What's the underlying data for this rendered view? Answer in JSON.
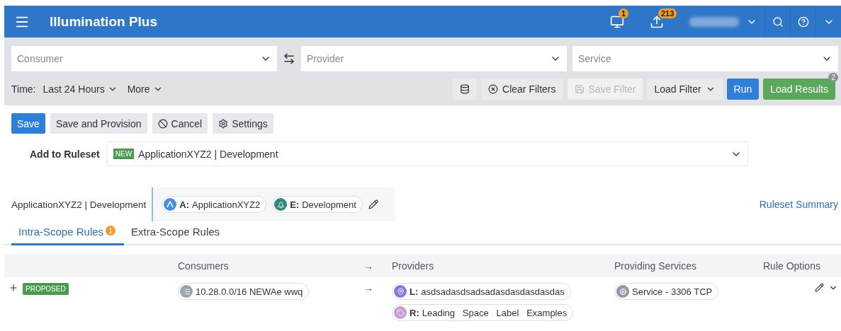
{
  "header": {
    "title": "Illumination Plus",
    "notifications": [
      {
        "kind": "monitor",
        "count": "1"
      },
      {
        "kind": "upload",
        "count": "213"
      }
    ]
  },
  "filters": {
    "consumer": {
      "placeholder": "Consumer"
    },
    "provider": {
      "placeholder": "Provider"
    },
    "service": {
      "placeholder": "Service"
    },
    "time_label": "Time:",
    "time_value": "Last 24 Hours",
    "more": "More",
    "buttons": [
      {
        "kind": "db",
        "disabled": false
      },
      {
        "kind": "clear",
        "label": "Clear Filters",
        "disabled": false
      },
      {
        "kind": "save",
        "label": "Save Filter",
        "disabled": true
      },
      {
        "kind": "load",
        "label": "Load Filter",
        "disabled": false
      },
      {
        "kind": "run",
        "label": "Run",
        "disabled": false
      },
      {
        "kind": "results",
        "label": "Load Results",
        "disabled": false,
        "badge": "2"
      }
    ]
  },
  "actions": [
    {
      "kind": "primary",
      "label": "Save"
    },
    {
      "kind": "plain",
      "label": "Save and Provision"
    },
    {
      "kind": "cancel",
      "label": "Cancel"
    },
    {
      "kind": "settings",
      "label": "Settings"
    }
  ],
  "ruleset": {
    "label": "Add to Ruleset",
    "badge": "NEW",
    "value": "ApplicationXYZ2 | Development"
  },
  "scope": {
    "name": "ApplicationXYZ2 | Development",
    "labels": [
      {
        "kind": "app",
        "key": "A:",
        "value": "ApplicationXYZ2",
        "color": "#4a90e2"
      },
      {
        "kind": "env",
        "key": "E:",
        "value": "Development",
        "color": "#2e8b7a"
      }
    ],
    "summary": "Ruleset Summary"
  },
  "tabs": [
    {
      "label": "Intra-Scope Rules",
      "badge": "1",
      "selected": true
    },
    {
      "label": "Extra-Scope Rules",
      "selected": false
    }
  ],
  "table": {
    "columns": [
      "Consumers",
      "→",
      "Providers",
      "Providing Services",
      "Rule Options"
    ],
    "rows": [
      {
        "status": "PROPOSED",
        "consumers": [
          {
            "kind": "iplist",
            "text": "10.28.0.0/16 NEWAe wwq"
          }
        ],
        "arrow": "→",
        "providers": [
          {
            "kind": "loc",
            "key": "L:",
            "value": "asdsadasdsadsadasdasdasdasdas"
          },
          {
            "kind": "role",
            "key": "R:",
            "value": "Leading   Space   Label   Examples"
          }
        ],
        "services": [
          {
            "kind": "service",
            "text": "Service - 3306 TCP"
          }
        ]
      }
    ]
  }
}
